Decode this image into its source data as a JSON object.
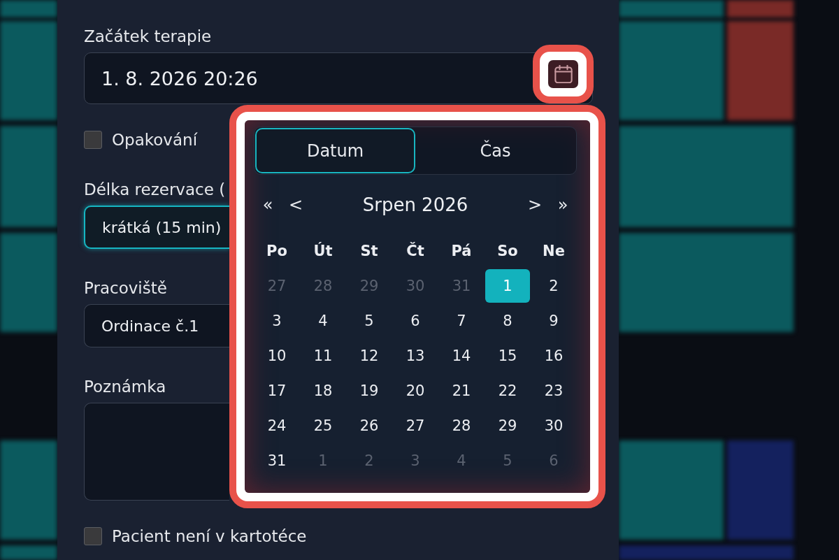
{
  "background_blocks": [
    {
      "color": "#0b5a5e"
    },
    {
      "color": "#0b5a5e"
    },
    {
      "color": "#0b5a5e"
    },
    {
      "color": "#0b5a5e"
    },
    {
      "color": "#0b5a5e"
    },
    {
      "color": "#0b5a5e"
    },
    {
      "color": "#0b5a5e"
    },
    {
      "color": "#7a2a27"
    },
    {
      "color": "#0b5a5e"
    },
    {
      "color": "#7a2a27"
    },
    {
      "color": "#0b5a5e"
    },
    {
      "color": "#0b5a5e"
    },
    {
      "color": "#0b5a5e"
    },
    {
      "color": "#14215e"
    },
    {
      "color": "#14215e"
    }
  ],
  "form": {
    "fields": [
      {
        "kind": "datetime",
        "label": "Začátek terapie",
        "value": "1. 8. 2026 20:26",
        "focused": false,
        "calendar_button": {
          "highlighted": true
        }
      },
      {
        "kind": "checkbox",
        "label": "Opakování",
        "checked": false
      },
      {
        "kind": "select",
        "label": "Délka rezervace (",
        "value": "krátká (15 min)",
        "focused": true
      },
      {
        "kind": "select",
        "label": "Pracoviště",
        "value": "Ordinace č.1",
        "focused": false
      },
      {
        "kind": "textarea",
        "label": "Poznámka",
        "focused": false
      },
      {
        "kind": "checkbox",
        "label": "Pacient není v kartotéce",
        "checked": false
      }
    ]
  },
  "date_picker": {
    "highlighted": true,
    "tabs": [
      {
        "label": "Datum",
        "selected": true
      },
      {
        "label": "Čas",
        "selected": false
      }
    ],
    "nav": {
      "prev_year": "«",
      "prev_month": "<",
      "month_label": "Srpen 2026",
      "next_month": ">",
      "next_year": "»"
    },
    "weekdays": [
      "Po",
      "Út",
      "St",
      "Čt",
      "Pá",
      "So",
      "Ne"
    ],
    "days": [
      {
        "label": "27",
        "outside_month": true,
        "selected": false
      },
      {
        "label": "28",
        "outside_month": true,
        "selected": false
      },
      {
        "label": "29",
        "outside_month": true,
        "selected": false
      },
      {
        "label": "30",
        "outside_month": true,
        "selected": false
      },
      {
        "label": "31",
        "outside_month": true,
        "selected": false
      },
      {
        "label": "1",
        "outside_month": false,
        "selected": true
      },
      {
        "label": "2",
        "outside_month": false,
        "selected": false
      },
      {
        "label": "3",
        "outside_month": false,
        "selected": false
      },
      {
        "label": "4",
        "outside_month": false,
        "selected": false
      },
      {
        "label": "5",
        "outside_month": false,
        "selected": false
      },
      {
        "label": "6",
        "outside_month": false,
        "selected": false
      },
      {
        "label": "7",
        "outside_month": false,
        "selected": false
      },
      {
        "label": "8",
        "outside_month": false,
        "selected": false
      },
      {
        "label": "9",
        "outside_month": false,
        "selected": false
      },
      {
        "label": "10",
        "outside_month": false,
        "selected": false
      },
      {
        "label": "11",
        "outside_month": false,
        "selected": false
      },
      {
        "label": "12",
        "outside_month": false,
        "selected": false
      },
      {
        "label": "13",
        "outside_month": false,
        "selected": false
      },
      {
        "label": "14",
        "outside_month": false,
        "selected": false
      },
      {
        "label": "15",
        "outside_month": false,
        "selected": false
      },
      {
        "label": "16",
        "outside_month": false,
        "selected": false
      },
      {
        "label": "17",
        "outside_month": false,
        "selected": false
      },
      {
        "label": "18",
        "outside_month": false,
        "selected": false
      },
      {
        "label": "19",
        "outside_month": false,
        "selected": false
      },
      {
        "label": "20",
        "outside_month": false,
        "selected": false
      },
      {
        "label": "21",
        "outside_month": false,
        "selected": false
      },
      {
        "label": "22",
        "outside_month": false,
        "selected": false
      },
      {
        "label": "23",
        "outside_month": false,
        "selected": false
      },
      {
        "label": "24",
        "outside_month": false,
        "selected": false
      },
      {
        "label": "25",
        "outside_month": false,
        "selected": false
      },
      {
        "label": "26",
        "outside_month": false,
        "selected": false
      },
      {
        "label": "27",
        "outside_month": false,
        "selected": false
      },
      {
        "label": "28",
        "outside_month": false,
        "selected": false
      },
      {
        "label": "29",
        "outside_month": false,
        "selected": false
      },
      {
        "label": "30",
        "outside_month": false,
        "selected": false
      },
      {
        "label": "31",
        "outside_month": false,
        "selected": false
      },
      {
        "label": "1",
        "outside_month": true,
        "selected": false
      },
      {
        "label": "2",
        "outside_month": true,
        "selected": false
      },
      {
        "label": "3",
        "outside_month": true,
        "selected": false
      },
      {
        "label": "4",
        "outside_month": true,
        "selected": false
      },
      {
        "label": "5",
        "outside_month": true,
        "selected": false
      },
      {
        "label": "6",
        "outside_month": true,
        "selected": false
      }
    ]
  }
}
